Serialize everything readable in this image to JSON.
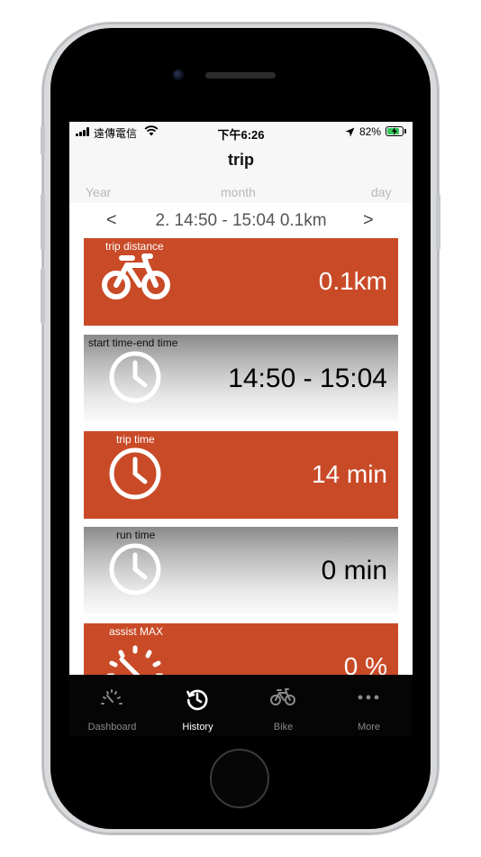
{
  "status_bar": {
    "carrier": "遠傳電信",
    "time": "下午6:26",
    "battery_percent": "82%",
    "battery_level": 0.82,
    "icons": [
      "signal-icon",
      "wifi-icon",
      "location-arrow-icon",
      "battery-charging-icon"
    ]
  },
  "nav": {
    "title": "trip"
  },
  "period_tabs": [
    "Year",
    "month",
    "day"
  ],
  "trip_selector": {
    "prev": "<",
    "label": "2. 14:50 - 15:04 0.1km",
    "next": ">"
  },
  "cards": [
    {
      "label": "trip distance",
      "value": "0.1km",
      "icon": "bicycle-icon",
      "style": "orange"
    },
    {
      "label": "start time-end time",
      "value": "14:50 - 15:04",
      "icon": "clock-icon",
      "style": "gray"
    },
    {
      "label": "trip time",
      "value": "14 min",
      "icon": "clock-icon",
      "style": "orange"
    },
    {
      "label": "run time",
      "value": "0 min",
      "icon": "clock-icon",
      "style": "gray"
    },
    {
      "label": "assist MAX",
      "value": "0 %",
      "icon": "speedometer-icon",
      "style": "orange"
    }
  ],
  "tab_bar": [
    {
      "label": "Dashboard",
      "icon": "speedometer-icon",
      "active": false
    },
    {
      "label": "History",
      "icon": "history-icon",
      "active": true
    },
    {
      "label": "Bike",
      "icon": "bicycle-icon",
      "active": false
    },
    {
      "label": "More",
      "icon": "more-dots-icon",
      "active": false
    }
  ],
  "colors": {
    "accent_orange": "#c94a27",
    "tab_bar_bg": "#050505",
    "battery_green": "#35c759"
  }
}
